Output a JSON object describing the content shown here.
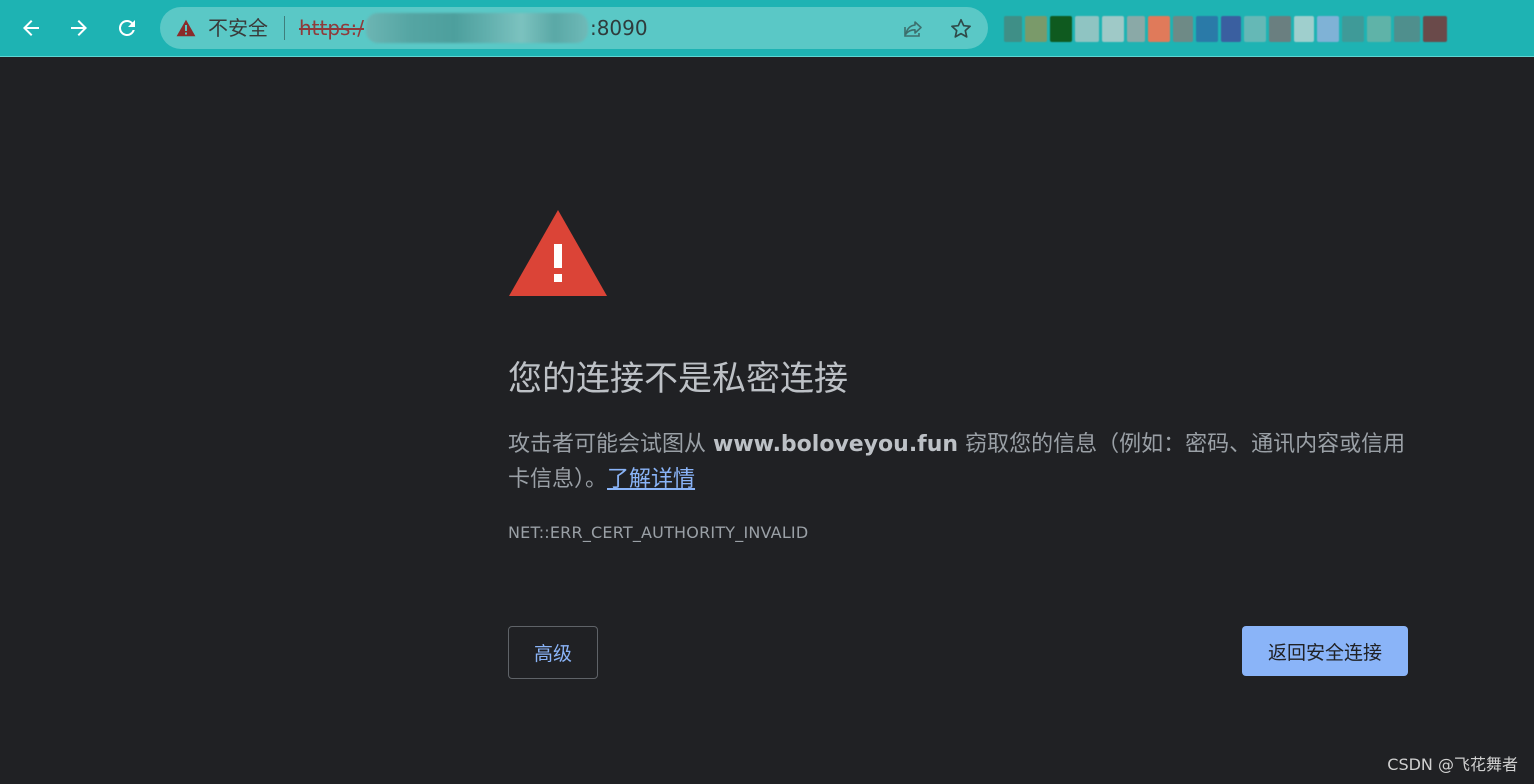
{
  "browser": {
    "security_chip": {
      "label": "不安全",
      "icon": "warning-triangle-icon"
    },
    "address_bar": {
      "scheme": "https:/",
      "port_suffix": ":8090"
    },
    "nav_icons": {
      "back": "back-arrow-icon",
      "forward": "forward-arrow-icon",
      "reload": "reload-icon",
      "share": "share-icon",
      "bookmark": "star-icon"
    },
    "accent_color": "#1eb3b3",
    "extension_colors": [
      "#3f8f87",
      "#7a9a6a",
      "#0f5a1f",
      "#8fc4c2",
      "#9fc9c7",
      "#8aa9a7",
      "#e07a5a",
      "#6e8a86",
      "#2a7aa8",
      "#3a5fa0",
      "#65b8b6",
      "#6a7f80",
      "#9fcfcd",
      "#7fb2d6",
      "#3f9a98",
      "#5fb3a8",
      "#4f8f8d",
      "#6a4a4a"
    ]
  },
  "interstitial": {
    "warning_icon": "red-warning-triangle-icon",
    "warning_color": "#db4437",
    "headline": "您的连接不是私密连接",
    "explanation_prefix": "攻击者可能会试图从 ",
    "domain": "www.boloveyou.fun",
    "explanation_suffix": " 窃取您的信息（例如：密码、通讯内容或信用卡信息）。",
    "learn_more": "了解详情",
    "error_code": "NET::ERR_CERT_AUTHORITY_INVALID",
    "advanced_button": "高级",
    "back_to_safety_button": "返回安全连接",
    "background_color": "#202124",
    "link_color": "#8ab4f8"
  },
  "watermark": "CSDN @飞花舞者"
}
